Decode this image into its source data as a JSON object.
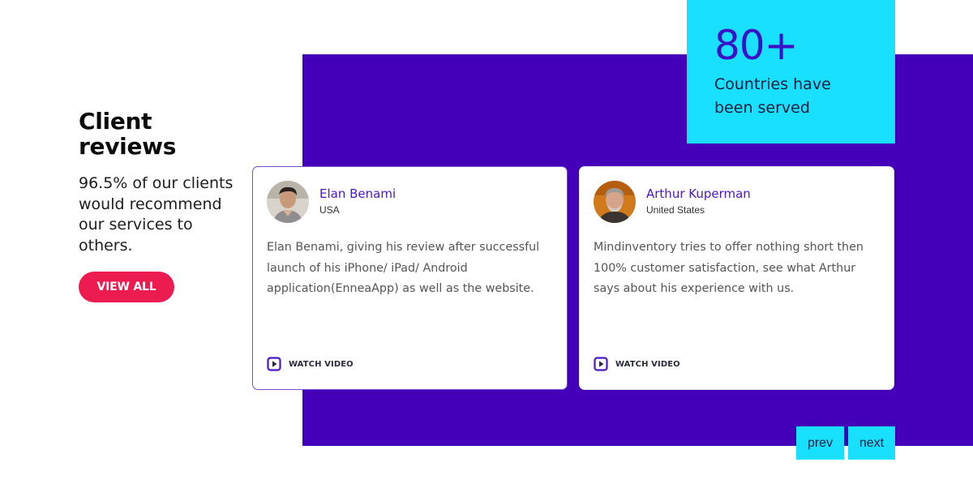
{
  "stat": {
    "number": "80+",
    "caption": "Countries have been served"
  },
  "intro": {
    "title": "Client reviews",
    "text": "96.5% of our clients would recommend our services to others.",
    "button_label": "VIEW ALL"
  },
  "reviews": [
    {
      "name": "Elan Benami",
      "country": "USA",
      "text": "Elan Benami,  giving his review after successful launch of his iPhone/ iPad/ Android application(EnneaApp) as well as the website.",
      "watch_label": "WATCH VIDEO",
      "avatar": "reviewer-photo"
    },
    {
      "name": "Arthur Kuperman",
      "country": "United States",
      "text": "Mindinventory tries to offer nothing short then 100% customer satisfaction, see what Arthur says about his experience with us.",
      "watch_label": "WATCH VIDEO",
      "avatar": "reviewer-photo"
    }
  ],
  "pager": {
    "prev_label": "prev",
    "next_label": "next"
  },
  "colors": {
    "brand_purple": "#4400b8",
    "accent_cyan": "#19e0ff",
    "cta_pink": "#ed1c50",
    "name_purple": "#4a17c8"
  },
  "icons": {
    "watch_video": "play-square-icon"
  }
}
